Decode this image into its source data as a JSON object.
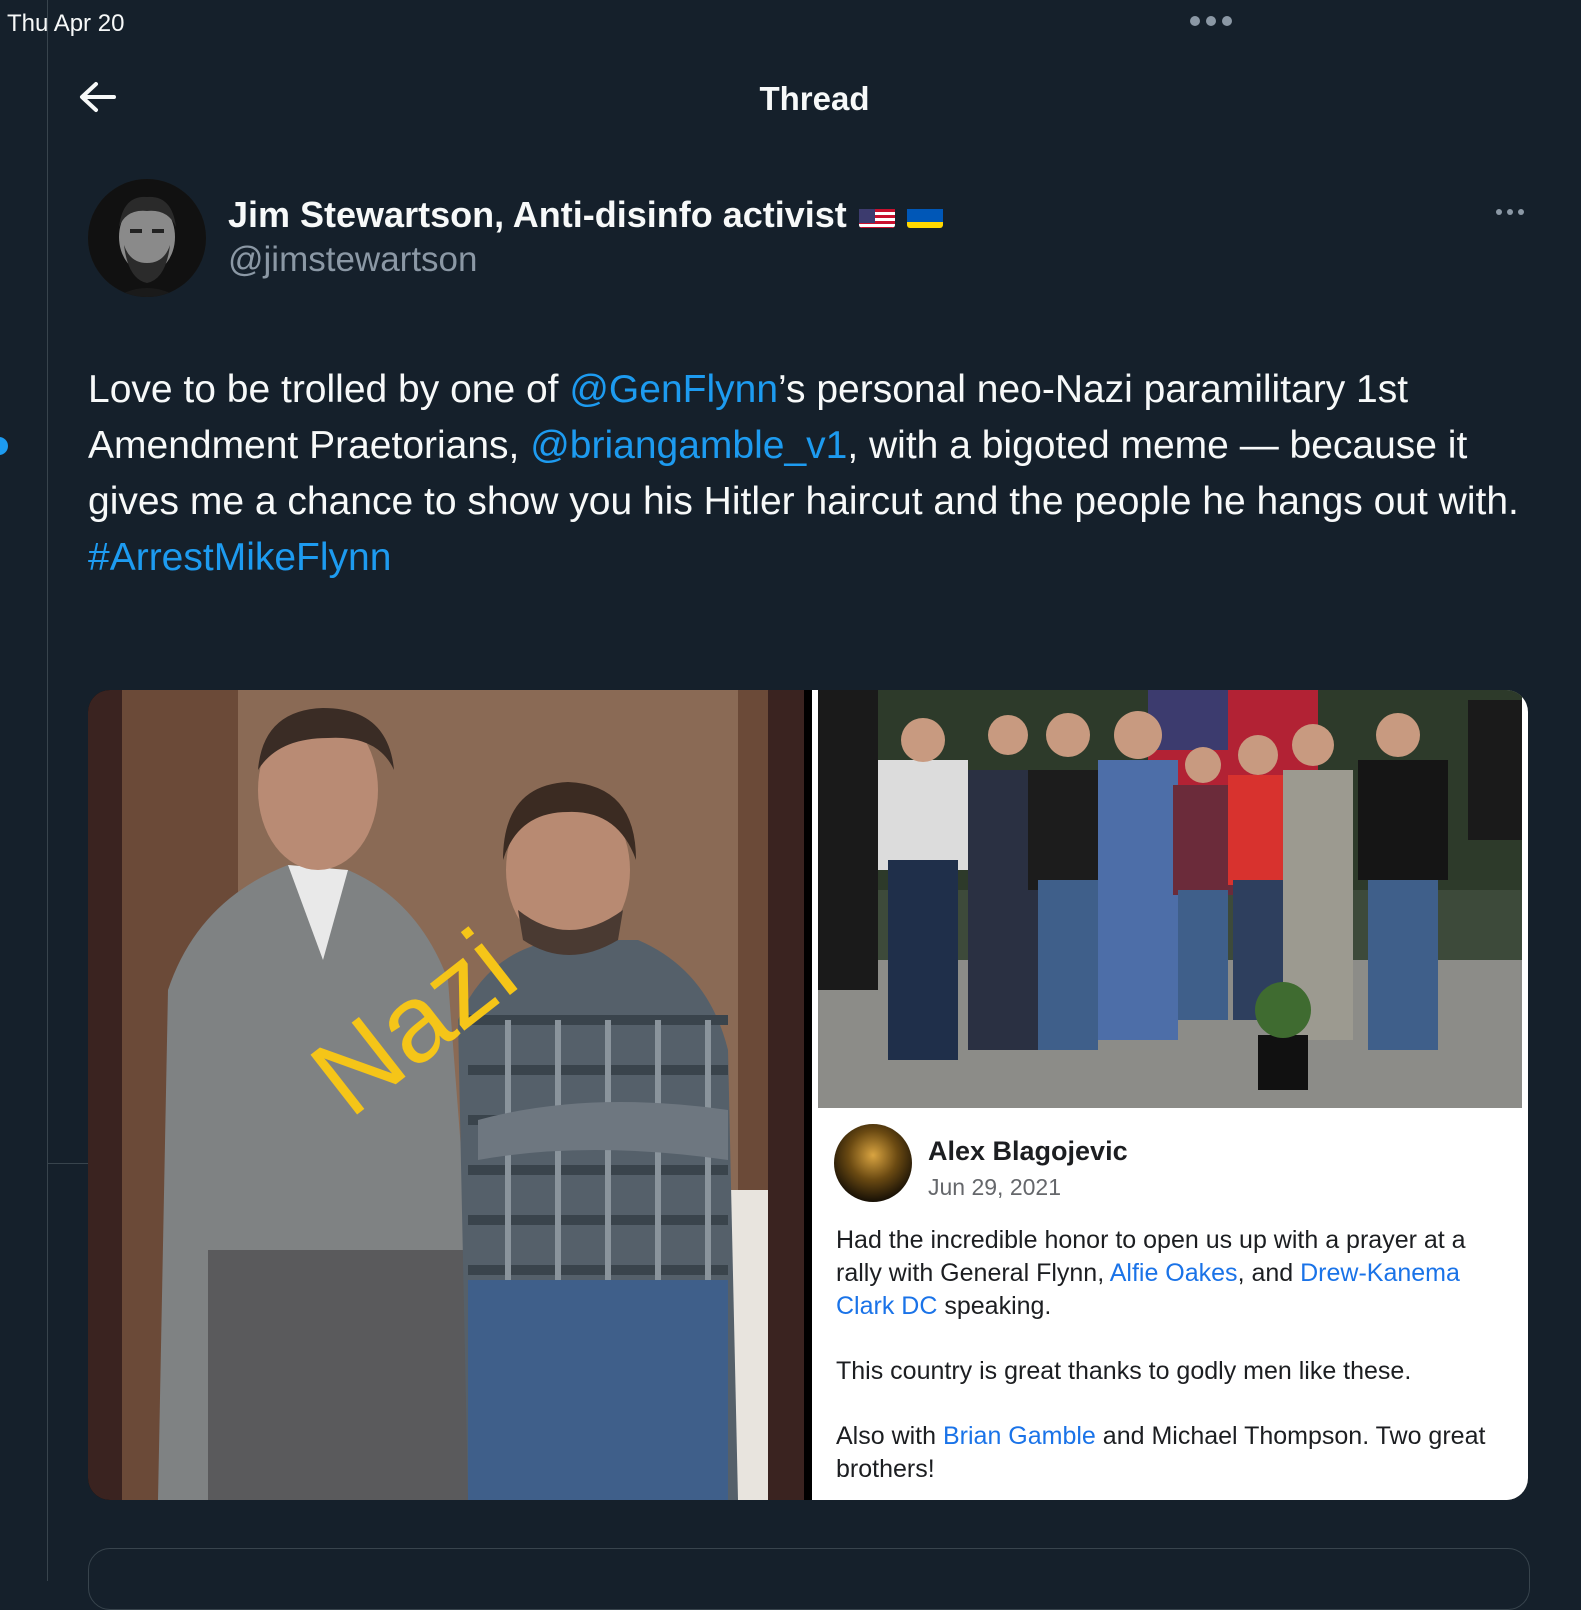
{
  "status_bar": {
    "time": "Thu Apr 20"
  },
  "header": {
    "title": "Thread",
    "back_icon": "arrow-left-icon"
  },
  "tweet": {
    "author_name": "Jim Stewartson, Anti-disinfo activist",
    "flags": [
      "us-flag-icon",
      "ukraine-flag-icon"
    ],
    "handle": "@jimstewartson",
    "text_parts": {
      "p1": "Love to be trolled by one of ",
      "mention1": "@GenFlynn",
      "p2": "’s personal neo-Nazi paramilitary 1st Amendment Praetorians, ",
      "mention2": "@briangamble_v1",
      "p3": ", with a bigoted meme — because it gives me a chance to show you his Hitler haircut and the people he hangs out with.",
      "hashtag": "#ArrestMikeFlynn"
    },
    "media": {
      "left_image": {
        "overlay_text": "Nazi"
      },
      "right_image": {
        "poster_name": "Alex Blagojevic",
        "post_date": "Jun 29, 2021",
        "line1_a": "Had the incredible honor to open us up with a prayer at a rally with General Flynn, ",
        "link1": "Alfie Oakes",
        "line1_b": ", and ",
        "link2": "Drew-Kanema Clark DC",
        "line1_c": " speaking.",
        "line2": "This country is great thanks to godly men like these.",
        "line3_a": "Also with ",
        "link3": "Brian Gamble",
        "line3_b": " and Michael Thompson. Two great brothers!"
      }
    }
  },
  "colors": {
    "background": "#15202b",
    "accent": "#1d9bf0",
    "secondary_text": "#8b98a5",
    "overlay_yellow": "#f5c518"
  }
}
